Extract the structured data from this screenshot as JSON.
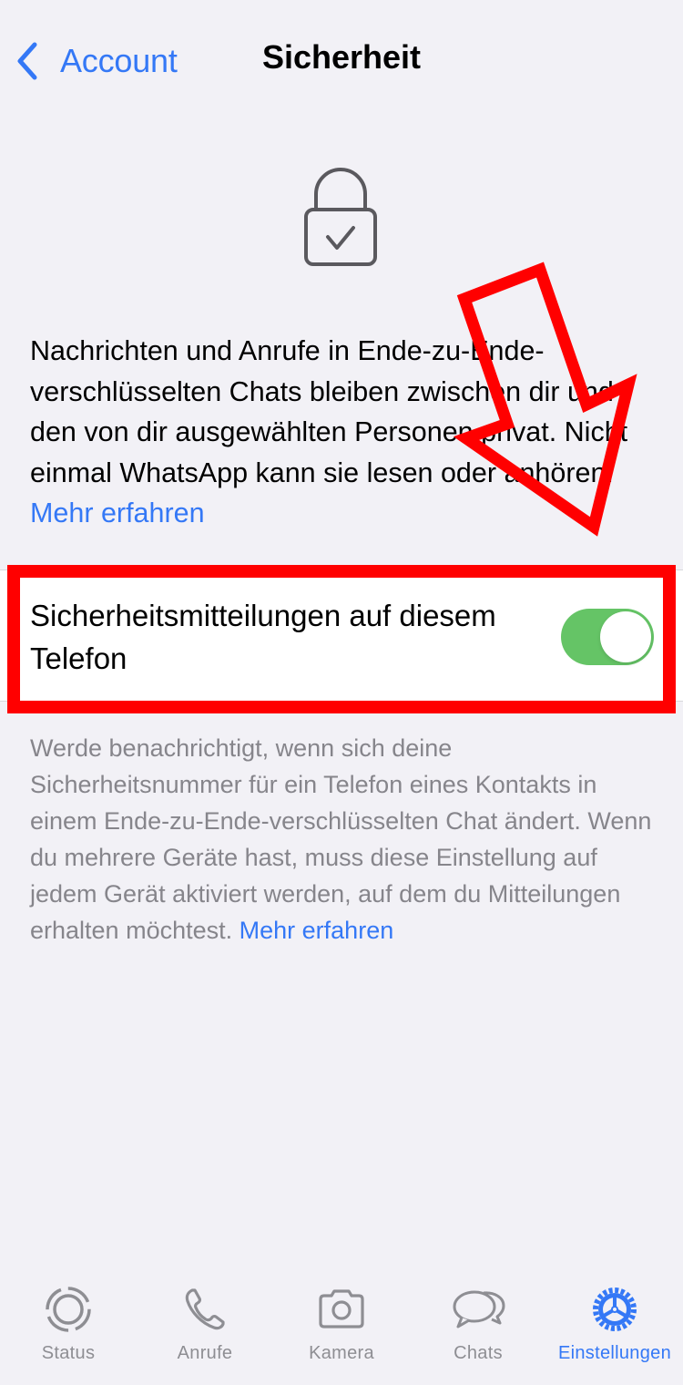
{
  "nav": {
    "back_label": "Account",
    "back_icon": "chevron-left-icon",
    "title": "Sicherheit"
  },
  "header_icon": "lock-check-icon",
  "intro": {
    "text": "Nachrichten und Anrufe in Ende-zu-Ende-verschlüsselten Chats bleiben zwischen dir und den von dir ausgewählten Personen privat. Nicht einmal WhatsApp kann sie lesen oder anhören.",
    "link": "Mehr erfahren"
  },
  "setting": {
    "label": "Sicherheitsmitteilungen auf diesem Telefon",
    "enabled": true
  },
  "footer": {
    "text": "Werde benachrichtigt, wenn sich deine Sicherheitsnummer für ein Telefon eines Kontakts in einem Ende-zu-Ende-verschlüsselten Chat ändert. Wenn du mehrere Geräte hast, muss diese Einstellung auf jedem Gerät aktiviert werden, auf dem du Mitteilungen erhalten möchtest.",
    "link": "Mehr erfahren"
  },
  "annotation": {
    "color": "#ff0000",
    "shapes": [
      "arrow-pointing-to-setting",
      "highlight-box-around-setting"
    ]
  },
  "tabbar": {
    "items": [
      {
        "label": "Status",
        "icon": "status-icon",
        "active": false
      },
      {
        "label": "Anrufe",
        "icon": "phone-icon",
        "active": false
      },
      {
        "label": "Kamera",
        "icon": "camera-icon",
        "active": false
      },
      {
        "label": "Chats",
        "icon": "chat-bubbles-icon",
        "active": false
      },
      {
        "label": "Einstellungen",
        "icon": "settings-gear-icon",
        "active": true
      }
    ]
  },
  "colors": {
    "accent": "#3478f6",
    "toggle_on": "#65c466",
    "background": "#f2f1f6",
    "secondary_text": "#86858b",
    "tab_inactive": "#8e8e93"
  }
}
